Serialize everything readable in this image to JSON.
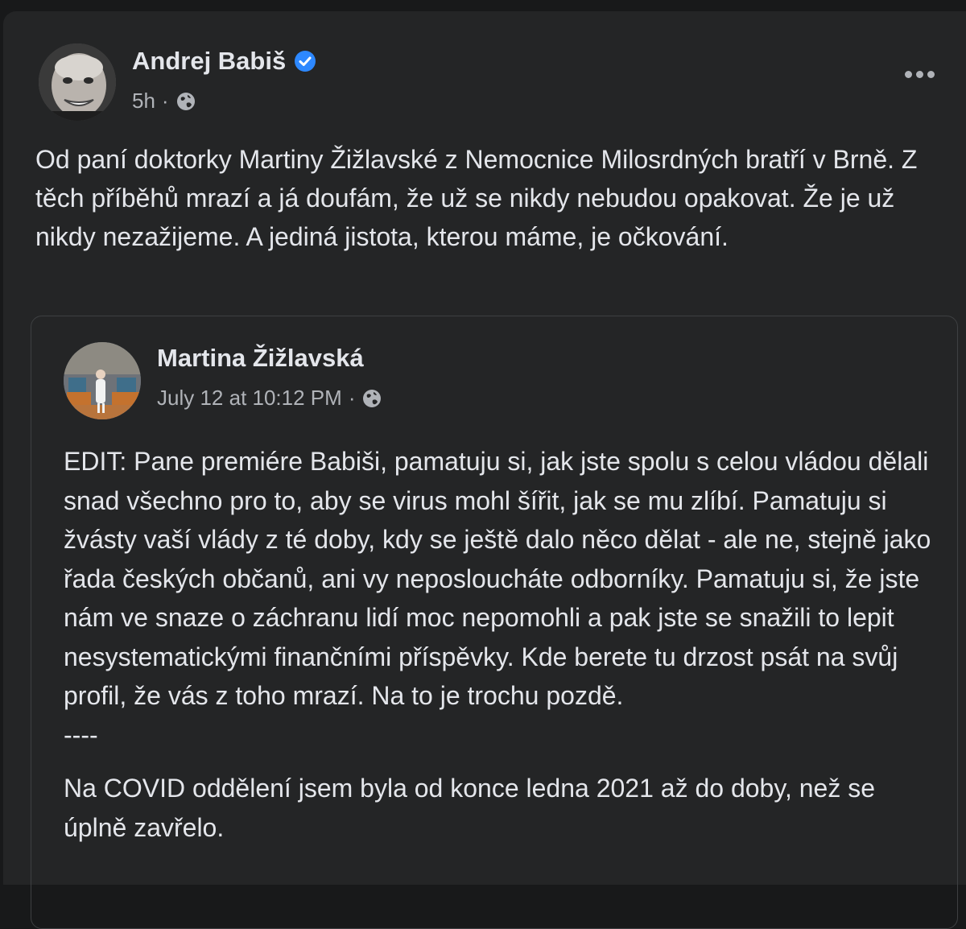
{
  "post": {
    "author": "Andrej Babiš",
    "timestamp": "5h",
    "separator": "·",
    "privacy_icon": "globe-icon",
    "verified_icon": "verified-badge-icon",
    "more_icon": "more-options-icon",
    "text": "Od paní doktorky Martiny Žižlavské z Nemocnice Milosrdných bratří v Brně. Z těch příběhů mrazí a já doufám, že už se nikdy nebudou opakovat. Že je už nikdy nezažijeme. A jediná jistota, kterou máme, je očkování."
  },
  "shared_post": {
    "author": "Martina Žižlavská",
    "timestamp": "July 12 at 10:12 PM",
    "separator": "·",
    "privacy_icon": "globe-icon",
    "paragraph_1": "EDIT: Pane premiére Babiši, pamatuju si, jak jste spolu s celou vládou dělali snad všechno pro to, aby se virus mohl šířit, jak se mu zlíbí. Pamatuju si žvásty vaší vlády z té doby, kdy se ještě dalo něco dělat - ale ne, stejně jako řada českých občanů, ani vy neposloucháte odborníky. Pamatuju si, že jste nám ve snaze o záchranu lidí moc nepomohli a pak jste se snažili to lepit nesystematickými finančními příspěvky. Kde berete tu drzost psát na svůj profil, že vás z toho mrazí. Na to je trochu pozdě.",
    "divider": "----",
    "paragraph_2": "Na COVID oddělení jsem byla od konce ledna 2021 až do doby, než se úplně zavřelo."
  },
  "colors": {
    "page_bg": "#18191a",
    "card_bg": "#242526",
    "text_primary": "#e4e6eb",
    "text_secondary": "#b0b3b8",
    "verified_blue": "#2d88ff",
    "border": "#3e4042"
  }
}
